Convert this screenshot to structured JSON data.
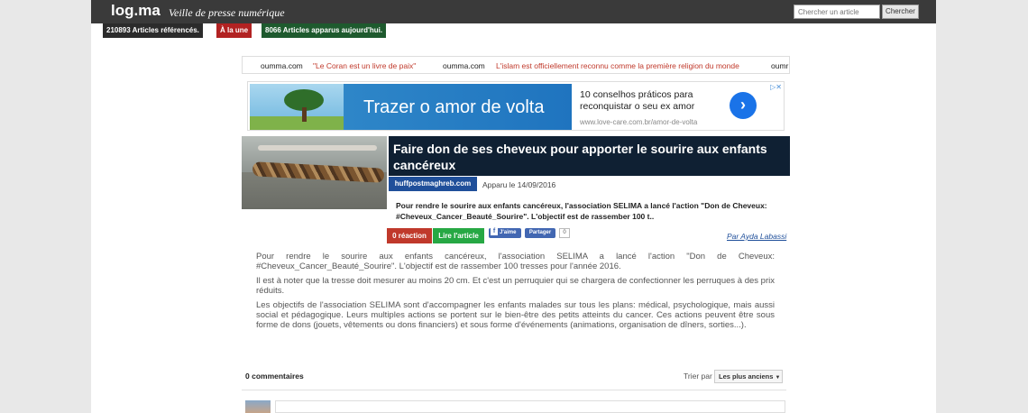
{
  "header": {
    "logo": "log.ma",
    "tagline": "Veille de presse numérique",
    "search_placeholder": "Chercher un article",
    "search_button": "Chercher"
  },
  "badges": [
    {
      "label": "210893 Articles référencés.",
      "color": "#2b2b2b"
    },
    {
      "label": "À la une",
      "color": "#b22222"
    },
    {
      "label": "8066 Articles apparus aujourd'hui.",
      "color": "#1e5a2e"
    }
  ],
  "ticker": [
    {
      "source": "oumma.com",
      "title": "\"Le Coran est un livre de paix\""
    },
    {
      "source": "oumma.com",
      "title": "L'islam est officiellement reconnu comme la première religion du monde"
    },
    {
      "source": "oumr",
      "title": ""
    }
  ],
  "ad": {
    "headline": "Trazer o amor de volta",
    "text": "10 conselhos práticos para reconquistar o seu ex amor",
    "url": "www.love-care.com.br/amor-de-volta",
    "arrow_icon": "chevron-right-icon",
    "close_icon": "ad-choices-close-icon"
  },
  "article": {
    "title": "Faire don de ses cheveux pour apporter le sourire aux enfants cancéreux",
    "source": "huffpostmaghreb.com",
    "date": "Apparu le 14/09/2016",
    "summary": "Pour rendre le sourire aux enfants cancéreux, l'association SELIMA a lancé l'action \"Don de Cheveux: #Cheveux_Cancer_Beauté_Sourire\". L'objectif est de rassember 100 t..",
    "reaction_label": "0 réaction",
    "read_label": "Lire l'article",
    "like_label": "J'aime",
    "share_label": "Partager",
    "share_count": "0",
    "author": "Par Ayda Labassi",
    "body": [
      "Pour rendre le sourire aux enfants cancéreux, l'association SELIMA a lancé l'action \"Don de Cheveux: #Cheveux_Cancer_Beauté_Sourire\". L'objectif est de rassember 100 tresses pour l'année 2016.",
      "Il est à noter que la tresse doit mesurer au moins 20 cm. Et c'est un perruquier qui se chargera de confectionner les perruques à des prix réduits.",
      "Les objectifs de l'association SELIMA sont d'accompagner les enfants malades sur tous les plans: médical, psychologique, mais aussi social et pédagogique. Leurs multiples actions se portent sur le bien-être des petits atteints du cancer. Ces actions peuvent être sous forme de dons (jouets, vêtements ou dons financiers) et sous forme d'événements (animations, organisation de dîners, sorties...)."
    ]
  },
  "comments": {
    "count_label": "0 commentaires",
    "sort_label": "Trier par",
    "sort_value": "Les plus anciens"
  }
}
